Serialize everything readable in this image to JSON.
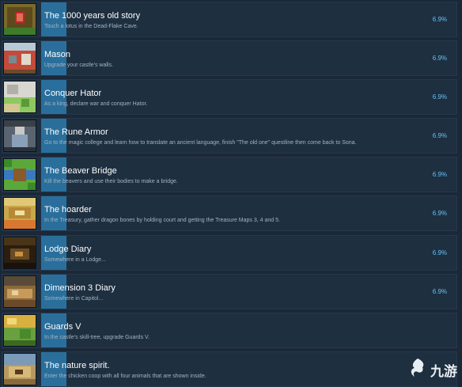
{
  "achievements": [
    {
      "title": "The 1000 years old story",
      "desc": "Touch a lotus in the Dead-Flake Cave.",
      "pct": "6.9%"
    },
    {
      "title": "Mason",
      "desc": "Upgrade your castle's walls.",
      "pct": "6.9%"
    },
    {
      "title": "Conquer Hator",
      "desc": "As a king, declare war and conquer Hator.",
      "pct": "6.9%"
    },
    {
      "title": "The Rune Armor",
      "desc": "Go to the magic college and learn how to translate an ancient language, finish \"The old one\" questline then come back to Sona.",
      "pct": "6.9%"
    },
    {
      "title": "The Beaver Bridge",
      "desc": "Kill the beavers and use their bodies to make a bridge.",
      "pct": "6.9%"
    },
    {
      "title": "The hoarder",
      "desc": "In the Treasury, gather dragon bones by holding court and getting the Treasure Maps 3, 4 and 5.",
      "pct": "6.9%"
    },
    {
      "title": "Lodge Diary",
      "desc": "Somewhere in a Lodge...",
      "pct": "6.9%"
    },
    {
      "title": "Dimension 3 Diary",
      "desc": "Somewhere in Capitol...",
      "pct": "6.9%"
    },
    {
      "title": "Guards V",
      "desc": "In the castle's skill-tree, upgrade Guards V.",
      "pct": ""
    },
    {
      "title": "The nature spirit.",
      "desc": "Enter the chicken coop with all four animals that are shown inside.",
      "pct": ""
    }
  ],
  "watermark": {
    "text": "九游"
  }
}
